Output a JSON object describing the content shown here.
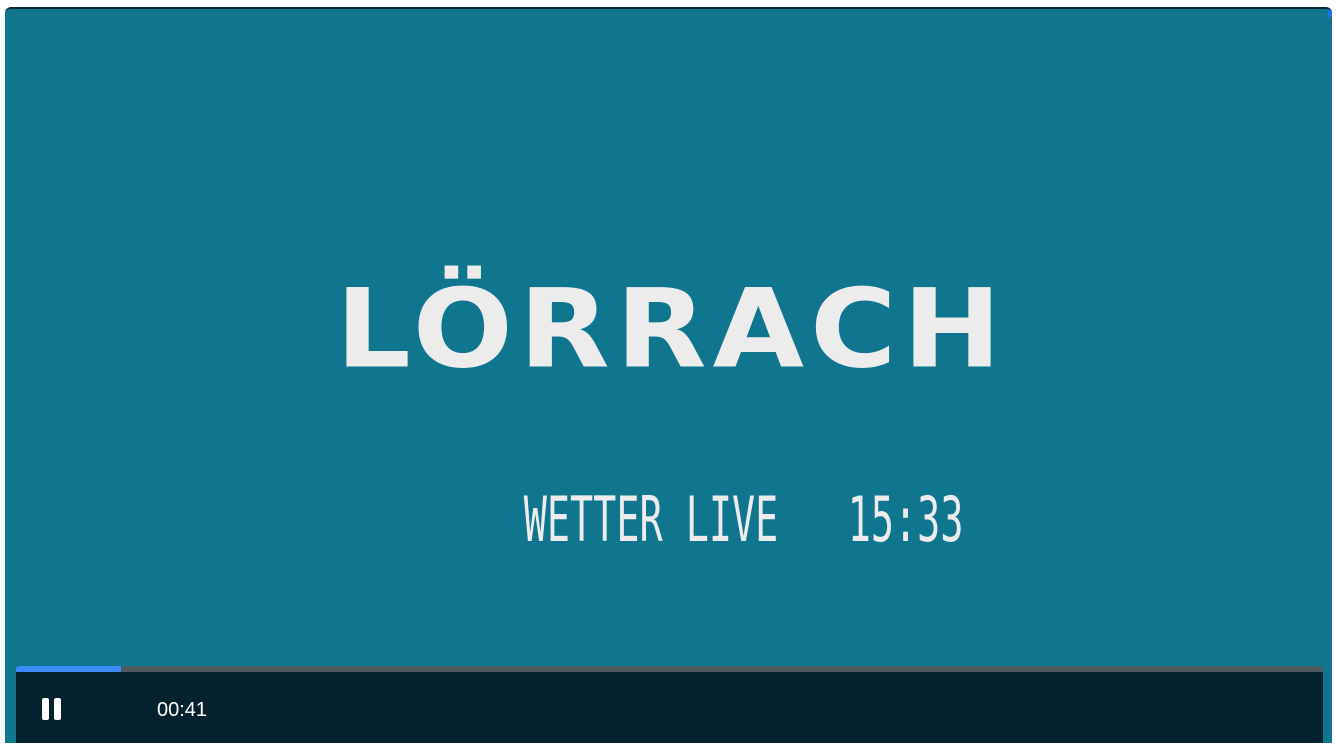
{
  "video": {
    "title": "LÖRRACH",
    "subtitle": "WETTER LIVE   15:33",
    "background_color": "#107690"
  },
  "player": {
    "pause_icon": "pause-icon",
    "elapsed_time": "00:41",
    "progress_fraction": 0.08,
    "progress_color": "#3d8cf5"
  }
}
